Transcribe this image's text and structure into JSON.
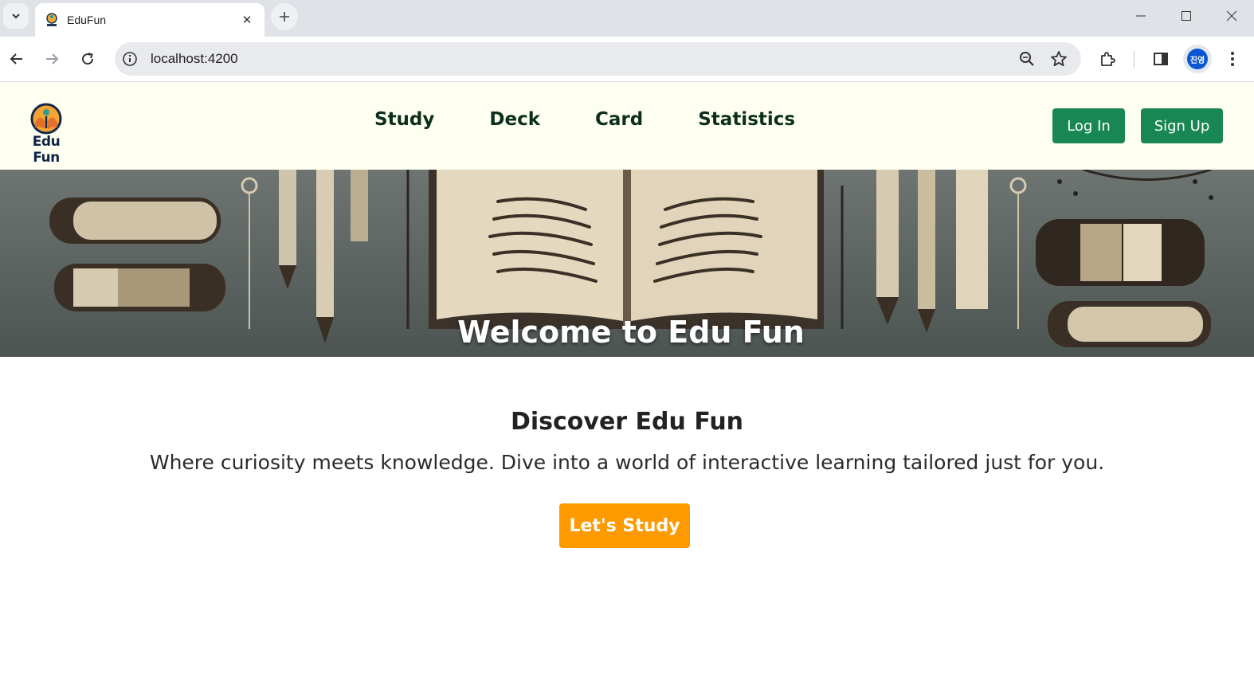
{
  "browser": {
    "tab_title": "EduFun",
    "url": "localhost:4200",
    "profile_initials": "진영"
  },
  "header": {
    "logo_text": "Edu Fun",
    "nav": [
      "Study",
      "Deck",
      "Card",
      "Statistics"
    ],
    "login_label": "Log In",
    "signup_label": "Sign Up"
  },
  "hero": {
    "title": "Welcome to Edu Fun"
  },
  "intro": {
    "title": "Discover Edu Fun",
    "text": "Where curiosity meets knowledge. Dive into a world of interactive learning tailored just for you.",
    "cta_label": "Let's Study"
  },
  "colors": {
    "header_bg": "#fefff0",
    "button_green": "#198754",
    "cta_orange": "#fd9a00"
  }
}
